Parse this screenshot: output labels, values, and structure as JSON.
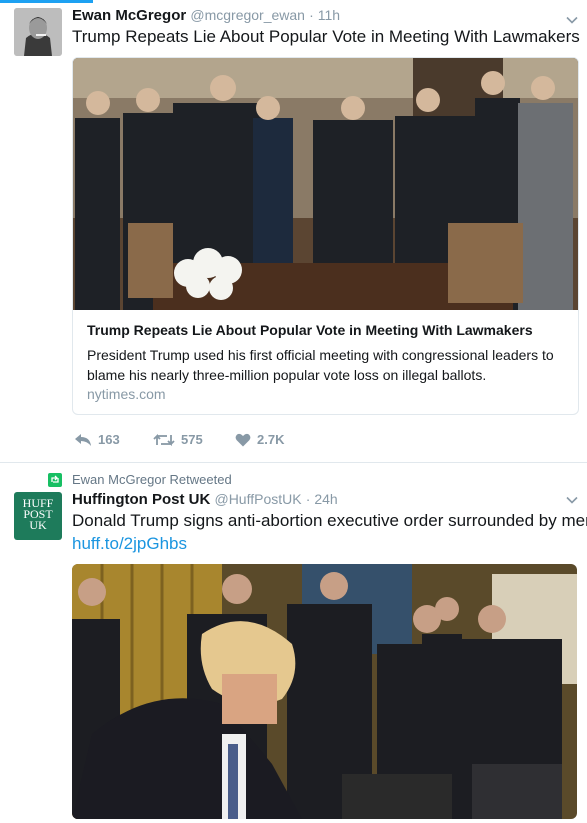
{
  "tweet1": {
    "author_name": "Ewan McGregor",
    "author_handle": "@mcgregor_ewan",
    "time": "· 11h",
    "text": "Trump Repeats Lie About Popular Vote in Meeting With Lawmakers",
    "card": {
      "title": "Trump Repeats Lie About Popular Vote in Meeting With Lawmakers",
      "description": "President Trump used his first official meeting with congressional leaders to blame his nearly three-million popular vote loss on illegal ballots.",
      "domain": "nytimes.com"
    },
    "actions": {
      "replies": "163",
      "retweets": "575",
      "likes": "2.7K"
    }
  },
  "tweet2": {
    "retweet_context": "Ewan McGregor Retweeted",
    "author_name": "Huffington Post UK",
    "author_handle": "@HuffPostUK",
    "time": "· 24h",
    "avatar_text": [
      "HUFF",
      "POST",
      "UK"
    ],
    "text": "Donald Trump signs anti-abortion executive order surrounded by men",
    "link": "huff.to/2jpGhbs"
  },
  "colors": {
    "accent": "#1da1f2",
    "huffpost_green": "#1e7b5b",
    "retweet_green": "#17bf63",
    "muted": "#8899a6"
  }
}
